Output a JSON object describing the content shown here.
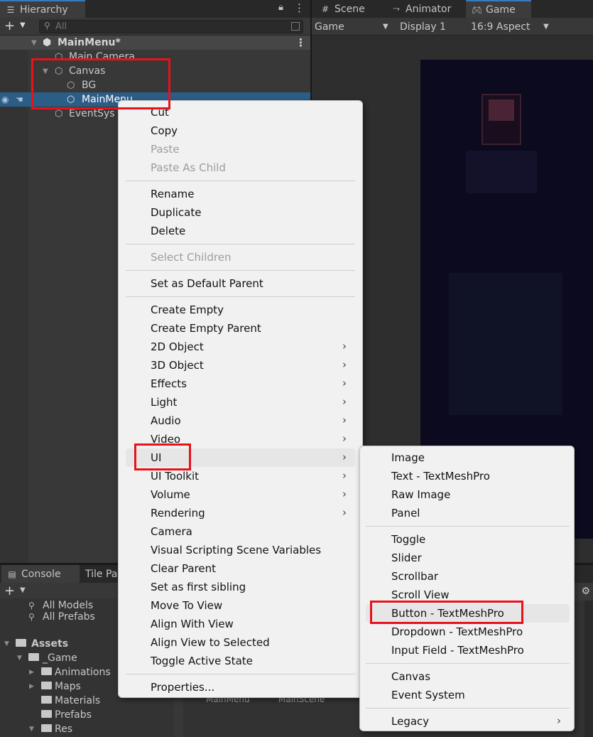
{
  "hierarchy": {
    "tab_label": "Hierarchy",
    "search_placeholder": "All",
    "scene_name": "MainMenu*",
    "items": [
      {
        "label": "Main Camera"
      },
      {
        "label": "Canvas"
      },
      {
        "label": "BG"
      },
      {
        "label": "MainMenu"
      },
      {
        "label": "EventSys"
      }
    ]
  },
  "game_view": {
    "tabs": [
      {
        "label": "Scene"
      },
      {
        "label": "Animator"
      },
      {
        "label": "Game"
      }
    ],
    "toolbar": {
      "view_select": "Game",
      "display_select": "Display 1",
      "aspect_select": "16:9 Aspect"
    }
  },
  "bottom_panel": {
    "tabs": [
      {
        "label": "Console"
      },
      {
        "label": "Tile Pa"
      }
    ],
    "project_tree": [
      {
        "label": "All Models"
      },
      {
        "label": "All Prefabs"
      },
      {
        "label": "Assets"
      },
      {
        "label": "_Game"
      },
      {
        "label": "Animations"
      },
      {
        "label": "Maps"
      },
      {
        "label": "Materials"
      },
      {
        "label": "Prefabs"
      },
      {
        "label": "Res"
      }
    ],
    "assets": [
      {
        "label": "MainMenu"
      },
      {
        "label": "MainScene"
      }
    ]
  },
  "context_menu": {
    "items": [
      {
        "label": "Cut"
      },
      {
        "label": "Copy"
      },
      {
        "label": "Paste"
      },
      {
        "label": "Paste As Child"
      },
      {
        "label": "Rename"
      },
      {
        "label": "Duplicate"
      },
      {
        "label": "Delete"
      },
      {
        "label": "Select Children"
      },
      {
        "label": "Set as Default Parent"
      },
      {
        "label": "Create Empty"
      },
      {
        "label": "Create Empty Parent"
      },
      {
        "label": "2D Object"
      },
      {
        "label": "3D Object"
      },
      {
        "label": "Effects"
      },
      {
        "label": "Light"
      },
      {
        "label": "Audio"
      },
      {
        "label": "Video"
      },
      {
        "label": "UI"
      },
      {
        "label": "UI Toolkit"
      },
      {
        "label": "Volume"
      },
      {
        "label": "Rendering"
      },
      {
        "label": "Camera"
      },
      {
        "label": "Visual Scripting Scene Variables"
      },
      {
        "label": "Clear Parent"
      },
      {
        "label": "Set as first sibling"
      },
      {
        "label": "Move To View"
      },
      {
        "label": "Align With View"
      },
      {
        "label": "Align View to Selected"
      },
      {
        "label": "Toggle Active State"
      },
      {
        "label": "Properties..."
      }
    ]
  },
  "ui_submenu": {
    "items": [
      {
        "label": "Image"
      },
      {
        "label": "Text - TextMeshPro"
      },
      {
        "label": "Raw Image"
      },
      {
        "label": "Panel"
      },
      {
        "label": "Toggle"
      },
      {
        "label": "Slider"
      },
      {
        "label": "Scrollbar"
      },
      {
        "label": "Scroll View"
      },
      {
        "label": "Button - TextMeshPro"
      },
      {
        "label": "Dropdown - TextMeshPro"
      },
      {
        "label": "Input Field - TextMeshPro"
      },
      {
        "label": "Canvas"
      },
      {
        "label": "Event System"
      },
      {
        "label": "Legacy"
      }
    ]
  },
  "colors": {
    "selection_blue": "#2c5d87",
    "highlight_red": "#e8121b",
    "menu_bg": "#f1f1f1"
  }
}
